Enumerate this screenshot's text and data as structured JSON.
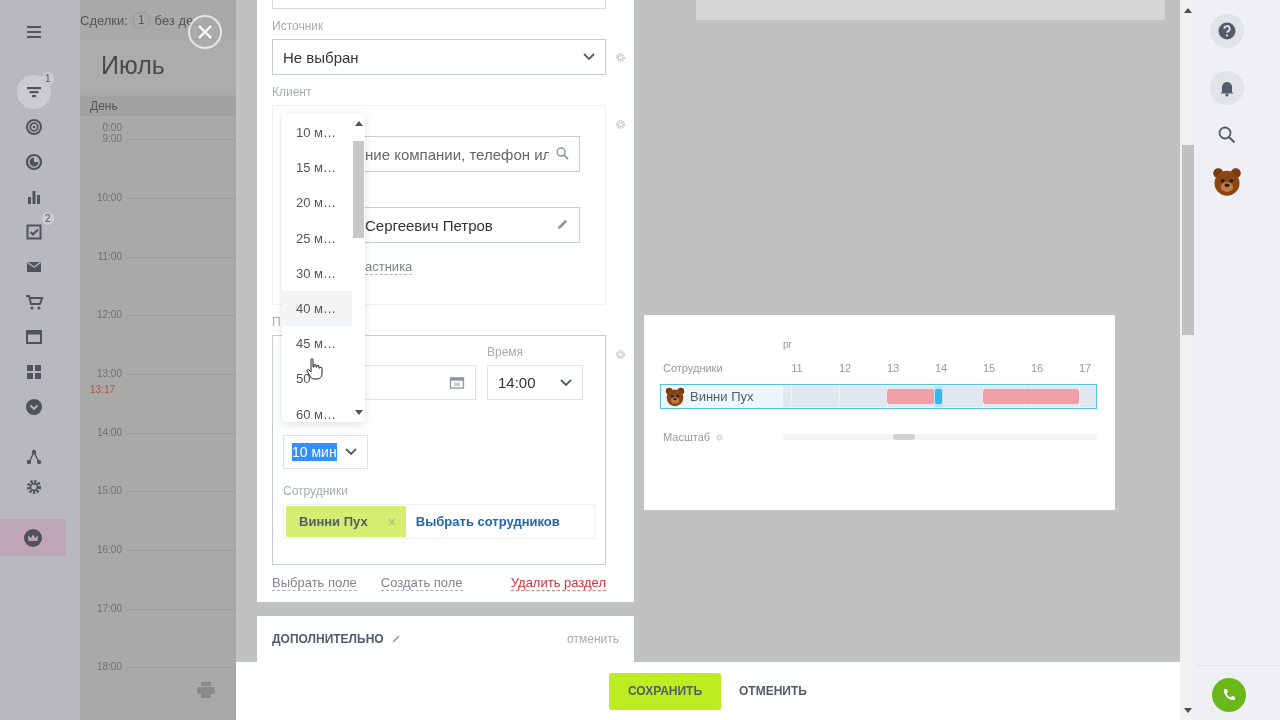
{
  "nav": {
    "groups": [
      {
        "items": [
          {
            "selected": false,
            "hovered": false
          }
        ]
      },
      {
        "items": [
          {
            "selected": false,
            "hovered": true,
            "badge": "1"
          },
          {
            "selected": false,
            "hovered": false
          },
          {
            "selected": false,
            "hovered": false
          },
          {
            "selected": false,
            "hovered": false
          },
          {
            "selected": false,
            "hovered": false,
            "badge": "2"
          },
          {
            "selected": false,
            "hovered": false
          },
          {
            "selected": false,
            "hovered": false
          },
          {
            "selected": false,
            "hovered": false
          },
          {
            "selected": false,
            "hovered": false
          },
          {
            "selected": false,
            "hovered": false
          }
        ]
      },
      {
        "items": [
          {
            "selected": false,
            "hovered": false
          },
          {
            "selected": false,
            "hovered": false
          }
        ]
      },
      {
        "items": [
          {
            "selected": true,
            "hovered": false
          }
        ]
      }
    ]
  },
  "header": {
    "label": "Сделки:",
    "count": "1",
    "text": "без де"
  },
  "calendar": {
    "month": "Июль",
    "view": "День",
    "hours": [
      {
        "label": "0:00",
        "kind": "collapsed"
      },
      {
        "label": "9:00",
        "kind": "hour"
      },
      {
        "label": "10:00",
        "kind": "hour"
      },
      {
        "label": "11:00",
        "kind": "hour"
      },
      {
        "label": "12:00",
        "kind": "hour"
      },
      {
        "label": "13:00",
        "kind": "hour"
      },
      {
        "label": "13:17",
        "kind": "now"
      },
      {
        "label": "14:00",
        "kind": "hour"
      },
      {
        "label": "15:00",
        "kind": "hour"
      },
      {
        "label": "16:00",
        "kind": "hour"
      },
      {
        "label": "17:00",
        "kind": "hour"
      },
      {
        "label": "18:00",
        "kind": "hour"
      }
    ]
  },
  "form": {
    "source": {
      "label": "Источник",
      "value": "Не выбран"
    },
    "client": {
      "label": "Клиент",
      "search": {
        "placeholder": "ние компании, телефон ил"
      },
      "contact": {
        "value": "Сергеевич Петров"
      },
      "link": "астника"
    },
    "section": {
      "label": "П",
      "time": {
        "label": "Время",
        "value": "14:00"
      },
      "duration": {
        "value": "10 мин",
        "text_selected": true
      },
      "employees": {
        "label": "Сотрудники",
        "tags": [
          {
            "label": "Винни Пух",
            "remove": "×"
          }
        ],
        "link": "Выбрать сотрудников"
      }
    },
    "links": [
      {
        "label": "Выбрать поле",
        "kind": "normal"
      },
      {
        "label": "Создать поле",
        "kind": "normal"
      },
      {
        "label": "Удалить раздел",
        "kind": "danger"
      }
    ]
  },
  "extra_card": {
    "title": "ДОПОЛНИТЕЛЬНО",
    "action": "отменить"
  },
  "duration_dropdown": {
    "options": [
      {
        "label": "10 м…",
        "highlighted": false
      },
      {
        "label": "15 м…",
        "highlighted": false
      },
      {
        "label": "20 м…",
        "highlighted": false
      },
      {
        "label": "25 м…",
        "highlighted": false
      },
      {
        "label": "30 м…",
        "highlighted": false
      },
      {
        "label": "40 м…",
        "highlighted": true
      },
      {
        "label": "45 м…",
        "highlighted": false
      },
      {
        "label": "50",
        "highlighted": false
      },
      {
        "label": "60 м…",
        "highlighted": false
      }
    ]
  },
  "timeline_popup": {
    "caption": "рг",
    "employees_label": "Сотрудники",
    "hours": [
      "11",
      "12",
      "13",
      "14",
      "15",
      "16",
      "17"
    ],
    "rows": [
      {
        "name": "Винни Пух"
      }
    ],
    "scale": {
      "label": "Масштаб",
      "level": 0.385
    }
  },
  "footer": {
    "buttons": [
      {
        "label": "СОХРАНИТЬ",
        "kind": "primary"
      },
      {
        "label": "ОТМЕНИТЬ",
        "kind": "secondary"
      }
    ]
  }
}
